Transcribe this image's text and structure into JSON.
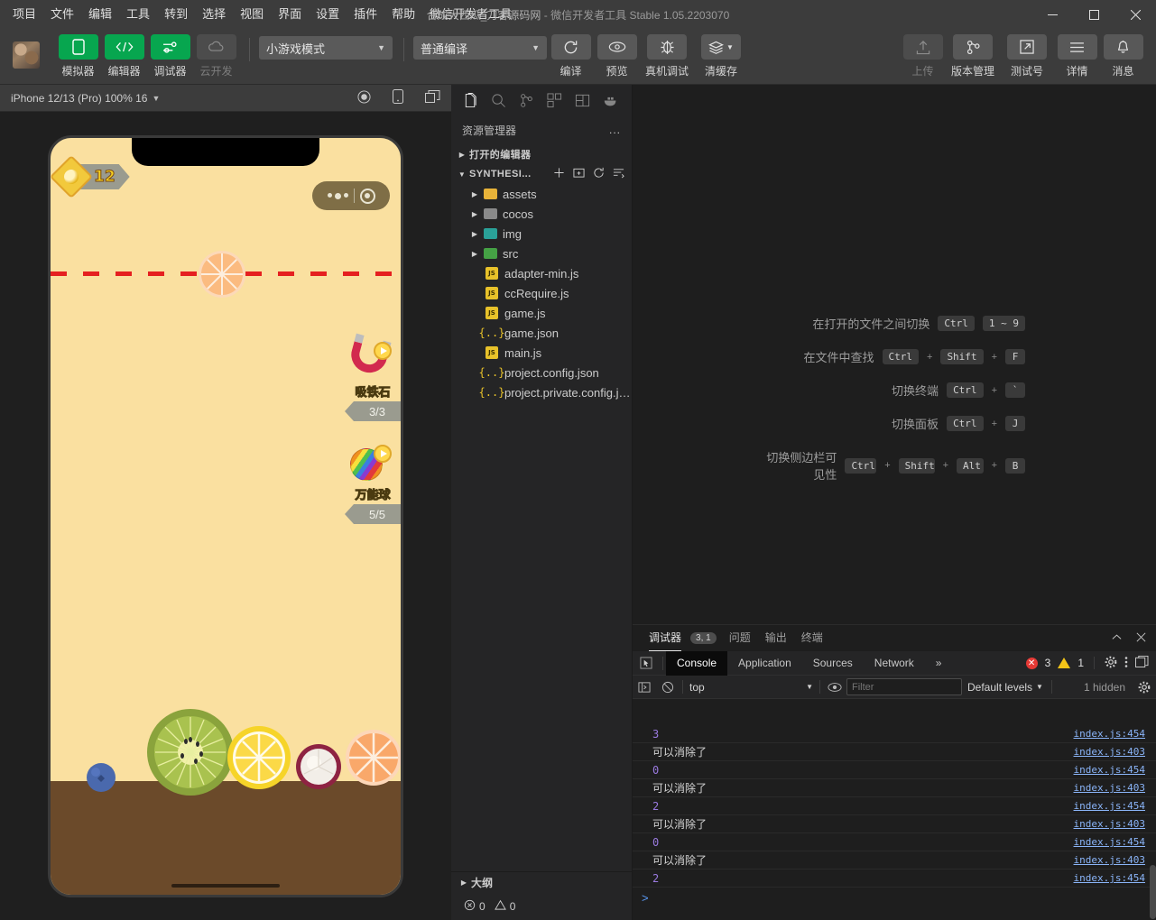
{
  "titlebar": {
    "menus": [
      "项目",
      "文件",
      "编辑",
      "工具",
      "转到",
      "选择",
      "视图",
      "界面",
      "设置",
      "插件",
      "帮助",
      "微信开发者工具"
    ],
    "project_name": "合成大西瓜_刀客源码网",
    "separator": "-",
    "app_name": "微信开发者工具",
    "version": "Stable 1.05.2203070",
    "minimize": "minimize-icon",
    "maximize": "maximize-icon",
    "close": "close-icon"
  },
  "toolbar": {
    "avatar": "user-avatar",
    "buttons": [
      {
        "label": "模拟器",
        "icon": "phone-icon",
        "style": "green"
      },
      {
        "label": "编辑器",
        "icon": "code-icon",
        "style": "green"
      },
      {
        "label": "调试器",
        "icon": "sliders-icon",
        "style": "green"
      },
      {
        "label": "云开发",
        "icon": "cloud-icon",
        "style": "disabled"
      }
    ],
    "mode_select": "小游戏模式",
    "compile_select": "普通编译",
    "actions": [
      {
        "label": "编译",
        "icon": "refresh-icon"
      },
      {
        "label": "预览",
        "icon": "eye-icon"
      },
      {
        "label": "真机调试",
        "icon": "bug-icon"
      },
      {
        "label": "清缓存",
        "icon": "layers-icon"
      }
    ],
    "right_actions": [
      {
        "label": "上传",
        "icon": "upload-icon",
        "style": "disabled"
      },
      {
        "label": "版本管理",
        "icon": "branch-icon"
      },
      {
        "label": "测试号",
        "icon": "external-link-icon"
      },
      {
        "label": "详情",
        "icon": "menu-icon"
      },
      {
        "label": "消息",
        "icon": "bell-icon"
      }
    ]
  },
  "simulator": {
    "device_label": "iPhone 12/13 (Pro) 100% 16",
    "icons": [
      "record-icon",
      "rotate-device-icon",
      "multi-window-icon"
    ],
    "game": {
      "score": "12",
      "powerups": [
        {
          "name": "吸铁石",
          "count": "3/3",
          "icon": "magnet-icon"
        },
        {
          "name": "万能球",
          "count": "5/5",
          "icon": "rainbow-ball-icon"
        }
      ],
      "capsule": "wechat-capsule-menu",
      "fruits": [
        "blueberry",
        "kiwi",
        "lemon",
        "mangosteen",
        "orange"
      ]
    }
  },
  "explorer": {
    "activity_icons": [
      "files-icon",
      "search-icon",
      "source-control-icon",
      "extensions-icon",
      "debug-icon",
      "docker-icon"
    ],
    "title": "资源管理器",
    "more": "...",
    "open_editors_label": "打开的编辑器",
    "project_label": "SYNTHESI...",
    "project_actions": [
      "new-file-icon",
      "new-folder-icon",
      "refresh-icon",
      "collapse-all-icon"
    ],
    "tree": [
      {
        "name": "assets",
        "type": "folder",
        "color": "yellow"
      },
      {
        "name": "cocos",
        "type": "folder",
        "color": "grey"
      },
      {
        "name": "img",
        "type": "folder",
        "color": "teal"
      },
      {
        "name": "src",
        "type": "folder",
        "color": "green"
      },
      {
        "name": "adapter-min.js",
        "type": "js"
      },
      {
        "name": "ccRequire.js",
        "type": "js"
      },
      {
        "name": "game.js",
        "type": "js"
      },
      {
        "name": "game.json",
        "type": "json"
      },
      {
        "name": "main.js",
        "type": "js"
      },
      {
        "name": "project.config.json",
        "type": "json"
      },
      {
        "name": "project.private.config.js...",
        "type": "json"
      }
    ],
    "outline_label": "大纲",
    "status": {
      "errors": "0",
      "warnings": "0"
    }
  },
  "editor": {
    "shortcuts": [
      {
        "label": "在打开的文件之间切换",
        "keys": [
          "Ctrl",
          "1 ~ 9"
        ],
        "seps": [
          ""
        ]
      },
      {
        "label": "在文件中查找",
        "keys": [
          "Ctrl",
          "Shift",
          "F"
        ],
        "seps": [
          "+",
          "+"
        ]
      },
      {
        "label": "切换终端",
        "keys": [
          "Ctrl",
          "`"
        ],
        "seps": [
          "+"
        ]
      },
      {
        "label": "切换面板",
        "keys": [
          "Ctrl",
          "J"
        ],
        "seps": [
          "+"
        ]
      },
      {
        "label": "切换侧边栏可见性",
        "keys": [
          "Ctrl",
          "Shift",
          "Alt",
          "B"
        ],
        "seps": [
          "+",
          "+",
          "+"
        ]
      }
    ]
  },
  "devpanel": {
    "tabs": [
      {
        "label": "调试器",
        "badge": "3, 1",
        "active": true
      },
      {
        "label": "问题",
        "badge": "",
        "active": false
      },
      {
        "label": "输出",
        "badge": "",
        "active": false
      },
      {
        "label": "终端",
        "badge": "",
        "active": false
      }
    ],
    "collapse_icon": "chevron-up-icon",
    "close_icon": "close-icon",
    "devtools_tabs": [
      {
        "label": "Console",
        "active": true
      },
      {
        "label": "Application",
        "active": false
      },
      {
        "label": "Sources",
        "active": false
      },
      {
        "label": "Network",
        "active": false
      },
      {
        "label": "»",
        "active": false
      }
    ],
    "error_count": "3",
    "warning_count": "1",
    "console": {
      "context": "top",
      "filter_placeholder": "Filter",
      "filter_value": "",
      "levels": "Default levels",
      "hidden": "1 hidden",
      "prompt": ">",
      "rows": [
        {
          "msg": "3",
          "type": "num",
          "src": "index.js:454"
        },
        {
          "msg": "可以消除了",
          "type": "text",
          "src": "index.js:403"
        },
        {
          "msg": "0",
          "type": "num",
          "src": "index.js:454"
        },
        {
          "msg": "可以消除了",
          "type": "text",
          "src": "index.js:403"
        },
        {
          "msg": "2",
          "type": "num",
          "src": "index.js:454"
        },
        {
          "msg": "可以消除了",
          "type": "text",
          "src": "index.js:403"
        },
        {
          "msg": "0",
          "type": "num",
          "src": "index.js:454"
        },
        {
          "msg": "可以消除了",
          "type": "text",
          "src": "index.js:403"
        },
        {
          "msg": "2",
          "type": "num",
          "src": "index.js:454"
        }
      ]
    }
  },
  "colors": {
    "accent_green": "#07a64f",
    "titlebar": "#3c3c3c",
    "editor_bg": "#1e1e1e",
    "sidebar_bg": "#252526",
    "game_bg": "#fae0a0",
    "ground": "#6b4a2a"
  }
}
